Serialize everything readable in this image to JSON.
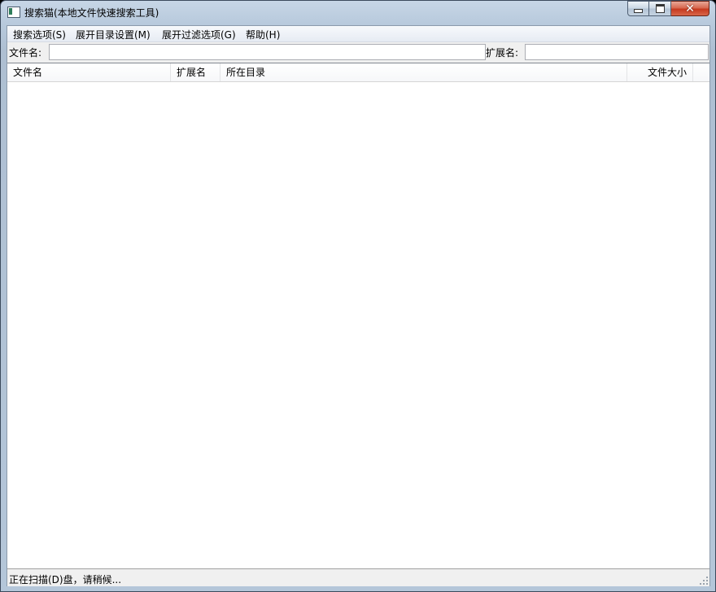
{
  "window": {
    "title": "搜索猫(本地文件快速搜索工具)",
    "controls": {
      "minimize": "minimize",
      "maximize": "maximize",
      "close": "✕"
    }
  },
  "menu": [
    {
      "label": "搜索选项(S)"
    },
    {
      "label": "展开目录设置(M)"
    },
    {
      "label": "展开过滤选项(G)"
    },
    {
      "label": "帮助(H)"
    }
  ],
  "filter": {
    "filename_label": "文件名:",
    "filename_value": "",
    "extension_label": "扩展名:",
    "extension_value": ""
  },
  "list": {
    "columns": [
      "文件名",
      "扩展名",
      "所在目录",
      "文件大小"
    ],
    "rows": []
  },
  "status": {
    "text": "正在扫描(D)盘，请稍候..."
  },
  "colors": {
    "title_gradient_top": "#c7d6e6",
    "close_button": "#c63a1f",
    "client_bg": "#f0f0f0",
    "list_bg": "#ffffff"
  }
}
